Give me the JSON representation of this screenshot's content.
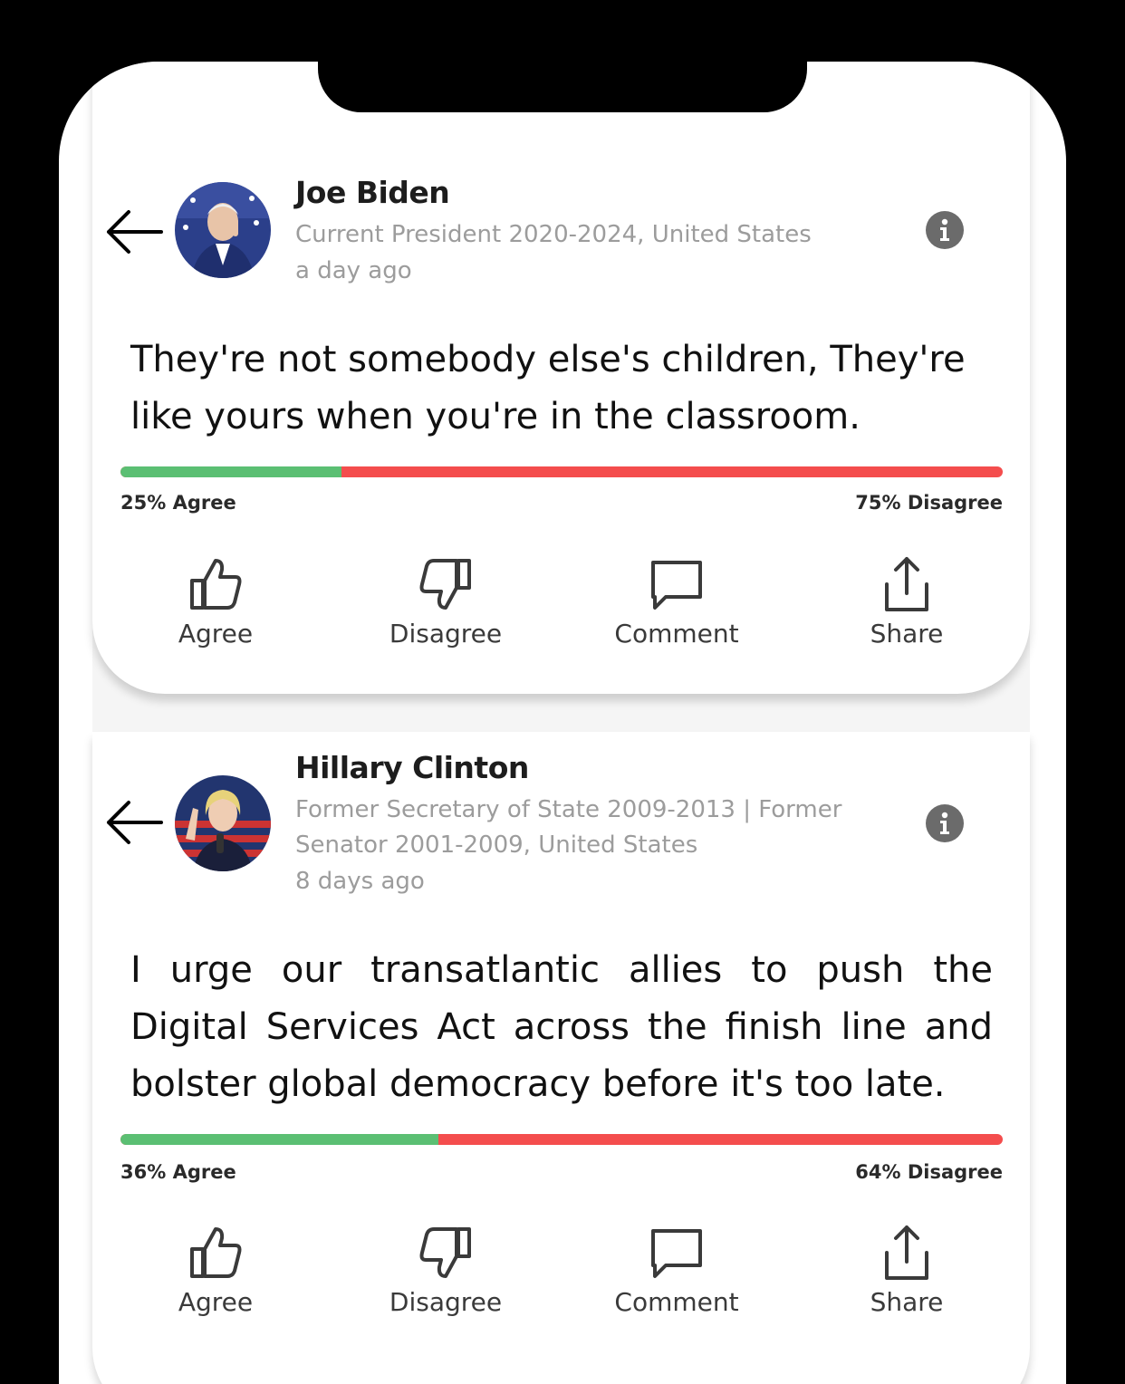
{
  "posts": [
    {
      "name": "Joe Biden",
      "role": "Current President 2020-2024, United States",
      "time": "a day ago",
      "quote": "They're not somebody else's children, They're like yours when you're in the classroom.",
      "agree_percent": 25,
      "agree_text": "25% Agree",
      "disagree_text": "75% Disagree"
    },
    {
      "name": "Hillary Clinton",
      "role": "Former Secretary of State 2009-2013 | Former Senator 2001-2009, United States",
      "time": "8 days ago",
      "quote": "I urge our transatlantic allies to push the Digital Services Act across the finish line and bolster global democracy before it's too late.",
      "agree_percent": 36,
      "agree_text": "36% Agree",
      "disagree_text": "64% Disagree"
    }
  ],
  "actions": {
    "agree": "Agree",
    "disagree": "Disagree",
    "comment": "Comment",
    "share": "Share"
  },
  "colors": {
    "agree": "#5bbf73",
    "disagree": "#f44d4d"
  }
}
